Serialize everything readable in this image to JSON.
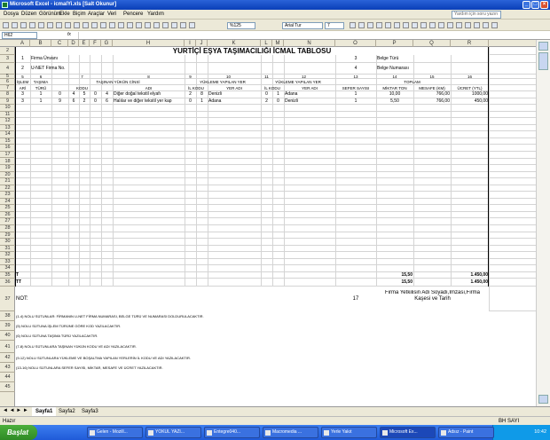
{
  "window": {
    "title": "Microsoft Excel - icmalYi.xls  [Salt Okunur]"
  },
  "menu": [
    "Dosya",
    "Düzen",
    "Görünüm",
    "Ekle",
    "Biçim",
    "Araçlar",
    "Veri",
    "Pencere",
    "Yardım"
  ],
  "help_placeholder": "Yardım için soru yazın",
  "toolbar": {
    "zoom": "%125",
    "font": "Arial Tur",
    "size": "7"
  },
  "formula": {
    "cell": "H62",
    "fx": "fx"
  },
  "columns": [
    "A",
    "B",
    "C",
    "D",
    "E",
    "F",
    "G",
    "H",
    "I",
    "J",
    "K",
    "L",
    "M",
    "N",
    "O",
    "P",
    "Q",
    "R"
  ],
  "rows": [
    "2",
    "3",
    "4",
    "5",
    "6",
    "7",
    "8",
    "9",
    "10",
    "11",
    "12",
    "13",
    "14",
    "15",
    "16",
    "17",
    "18",
    "19",
    "20",
    "21",
    "22",
    "23",
    "24",
    "25",
    "26",
    "27",
    "28",
    "29",
    "30",
    "31",
    "32",
    "33",
    "34",
    "35",
    "36",
    "37",
    "38",
    "39",
    "40",
    "41",
    "42",
    "43",
    "44",
    "45"
  ],
  "form": {
    "title": "YURTİÇİ EŞYA TAŞIMACILIĞI İCMAL TABLOSU",
    "n1": "1",
    "firma": "Firma Ünvanı",
    "n2": "2",
    "unet": "U-NET Firma No.",
    "n3": "3",
    "belge_turu": "Belge Türü",
    "n4": "4",
    "belge_no": "Belge Numarası",
    "nums": [
      "5",
      "6",
      "7",
      "8",
      "9",
      "10",
      "11",
      "12",
      "13",
      "14",
      "15",
      "16"
    ],
    "h_islem": "İŞLEM",
    "h_tasima": "TAŞIMA",
    "h_yuk": "TAŞINAN YÜKÜN CİNSİ",
    "h_yukleme": "YÜKLEME YAPILAN YER",
    "h_bosaltma": "YÜKLEME YAPILAN YER",
    "h_toplam": "TOPLAM",
    "h_ari": "ARİ",
    "h_turu": "TÜRÜ",
    "h_kodu": "KODU",
    "h_adi": "ADI",
    "h_ilkodu": "İL KODU",
    "h_yeradi": "YER ADI",
    "h_ilkodu2": "İL KODU",
    "h_yeradi2": "YER ADI",
    "h_sefer": "SEFER SAYISI",
    "h_miktar": "MİKTAR TON",
    "h_mesafe": "MESAFE (KM)",
    "h_ucret": "ÜCRET (YTL)",
    "data_rows": [
      {
        "islem": "3",
        "tur": "1",
        "kod": [
          "0",
          "4",
          "5",
          "0",
          "4"
        ],
        "adi": "Diğer doğal tekstil elyafı",
        "il": [
          "2",
          "8"
        ],
        "yer": "Denizli",
        "il2": [
          "0",
          "1"
        ],
        "yer2": "Adana",
        "sefer": "1",
        "miktar": "10,00",
        "mesafe": "766,00",
        "ucret": "1000,00"
      },
      {
        "islem": "3",
        "tur": "1",
        "kod": [
          "9",
          "6",
          "2",
          "0",
          "6"
        ],
        "adi": "Halılar ve diğer tekstil yer kap",
        "il": [
          "0",
          "1"
        ],
        "yer": "Adana",
        "il2": [
          "2",
          "0"
        ],
        "yer2": "Denizli",
        "sefer": "1",
        "miktar": "5,50",
        "mesafe": "766,00",
        "ucret": "450,00"
      }
    ],
    "t1": "T",
    "t1_miktar": "15,50",
    "t1_ucret": "1.450,00",
    "t2": "TT",
    "t2_miktar": "15,50",
    "t2_ucret": "1.450,00",
    "not": "NOT:",
    "n17": "17",
    "imza": "Firma Yetkilisin Adı Soyadı,İmzası,Firma Kaşesi ve Tarih",
    "notes": [
      "(1-4) NOLU SÜTUNLAR: FİRMANIN U-NET FİRMA NUMARASI, BELGE TÜRÜ VE NUMARASI DOLDURULACAKTIR.",
      "(5) NOLU SÜTUNA İŞLEM TÜRÜNE GÖRE KOD YAZILACAKTIR.",
      "(6) NOLU SÜTUNA TAŞIMA TÜRÜ YAZILACAKTIR.",
      "(7-8) NOLU SÜTUNLARA TAŞINAN YÜKÜN KODU VE ADI YAZILACAKTIR.",
      "(9-12) NOLU SÜTUNLARA YÜKLEME VE BOŞALTMA YAPILAN YERLERİN İL KODU VE ADI YAZILACAKTIR.",
      "(13-16) NOLU SÜTUNLARA SEFER SAYISI, MİKTAR, MESAFE VE ÜCRET YAZILACAKTIR."
    ]
  },
  "sheets": [
    "Sayfa1",
    "Sayfa2",
    "Sayfa3"
  ],
  "status": {
    "left": "Hazır",
    "right": "BH SAYI"
  },
  "taskbar": {
    "start": "Başlat",
    "tasks": [
      "Gelen - Mozill...",
      "YOKUL YAZI...",
      "Entegre040...",
      "Macromedia ...",
      "Yerle Yakıt",
      "Microsoft Ex...",
      "Adsız - Paint"
    ],
    "clock": "10:42"
  },
  "colors": {
    "title": "#0a3fb8",
    "grid": "#d4d4d4",
    "taskbar": "#1f5ad8",
    "start": "#2f8a26"
  }
}
